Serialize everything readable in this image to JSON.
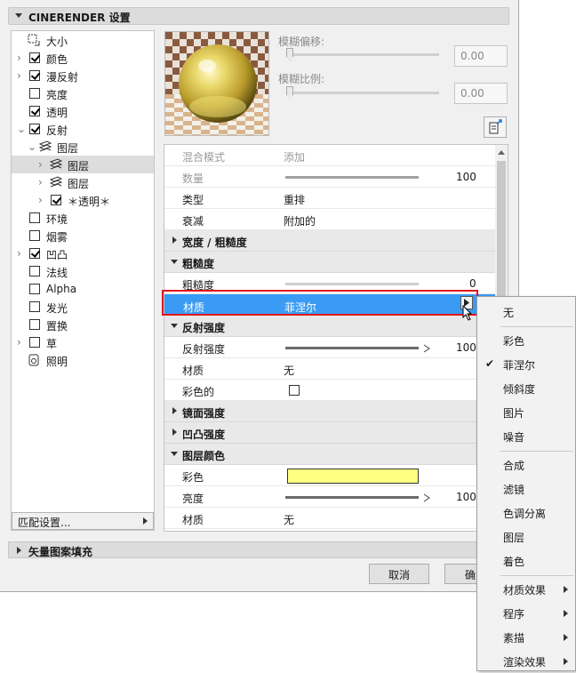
{
  "header": {
    "title": "CINERENDER 设置"
  },
  "tree": {
    "items": [
      {
        "label": "大小",
        "expander": false,
        "checkbox": null,
        "icon": "resize-icon",
        "indent": 0
      },
      {
        "label": "颜色",
        "expander": true,
        "checkbox": true,
        "indent": 0
      },
      {
        "label": "漫反射",
        "expander": true,
        "checkbox": true,
        "indent": 0
      },
      {
        "label": "亮度",
        "expander": false,
        "checkbox": false,
        "indent": 0
      },
      {
        "label": "透明",
        "expander": false,
        "checkbox": true,
        "indent": 0
      },
      {
        "label": "反射",
        "expander": "open",
        "checkbox": true,
        "indent": 0
      },
      {
        "label": "图层",
        "expander": "open",
        "checkbox": null,
        "icon": "layers-icon",
        "indent": 1
      },
      {
        "label": "图层",
        "expander": true,
        "checkbox": null,
        "icon": "layers-icon",
        "indent": 2,
        "selected": true
      },
      {
        "label": "图层",
        "expander": true,
        "checkbox": null,
        "icon": "layers-icon",
        "indent": 2
      },
      {
        "label": "＊透明＊",
        "expander": true,
        "checkbox": true,
        "indent": 2
      },
      {
        "label": "环境",
        "expander": false,
        "checkbox": false,
        "indent": 0
      },
      {
        "label": "烟雾",
        "expander": false,
        "checkbox": false,
        "indent": 0
      },
      {
        "label": "凹凸",
        "expander": true,
        "checkbox": true,
        "indent": 0
      },
      {
        "label": "法线",
        "expander": false,
        "checkbox": false,
        "indent": 0
      },
      {
        "label": "Alpha",
        "expander": false,
        "checkbox": false,
        "indent": 0
      },
      {
        "label": "发光",
        "expander": false,
        "checkbox": false,
        "indent": 0
      },
      {
        "label": "置换",
        "expander": false,
        "checkbox": false,
        "indent": 0
      },
      {
        "label": "草",
        "expander": true,
        "checkbox": false,
        "indent": 0
      },
      {
        "label": "照明",
        "expander": false,
        "checkbox": null,
        "icon": "lighting-icon",
        "indent": 0
      }
    ],
    "match_button": "匹配设置..."
  },
  "blur": {
    "offset_label": "模糊偏移:",
    "offset_value": "0.00",
    "offset_level": 0,
    "scale_label": "模糊比例:",
    "scale_value": "0.00",
    "scale_level": 0
  },
  "props": [
    {
      "type": "row",
      "dim": true,
      "key": "混合模式",
      "value": "添加"
    },
    {
      "type": "slider",
      "dim": true,
      "key": "数量",
      "value": "100",
      "level": 1.0
    },
    {
      "type": "row",
      "key": "类型",
      "value": "重排"
    },
    {
      "type": "row",
      "key": "衰减",
      "value": "附加的"
    },
    {
      "type": "group",
      "open": false,
      "key": "宽度 / 粗糙度"
    },
    {
      "type": "group",
      "open": true,
      "key": "粗糙度"
    },
    {
      "type": "slider",
      "key": "粗糙度",
      "value": "0",
      "level": 0.0
    },
    {
      "type": "row",
      "key": "材质",
      "value": "菲涅尔",
      "selected": true
    },
    {
      "type": "group",
      "open": true,
      "key": "反射强度"
    },
    {
      "type": "slider",
      "key": "反射强度",
      "value": "100",
      "level": 1.0,
      "arrow": true
    },
    {
      "type": "row",
      "key": "材质",
      "value": "无"
    },
    {
      "type": "check",
      "key": "彩色的",
      "checked": false
    },
    {
      "type": "group",
      "open": false,
      "key": "镜面强度"
    },
    {
      "type": "group",
      "open": false,
      "key": "凹凸强度"
    },
    {
      "type": "group",
      "open": true,
      "key": "图层颜色"
    },
    {
      "type": "color",
      "key": "彩色",
      "color": "#ffff80"
    },
    {
      "type": "slider",
      "key": "亮度",
      "value": "100",
      "level": 1.0,
      "arrow": true
    },
    {
      "type": "row",
      "key": "材质",
      "value": "无"
    }
  ],
  "bottom": {
    "vector_title": "矢量图案填充",
    "cancel": "取消",
    "ok": "确"
  },
  "menu": {
    "items": [
      {
        "label": "无"
      },
      {
        "sep": true
      },
      {
        "label": "彩色"
      },
      {
        "label": "菲涅尔",
        "checked": true
      },
      {
        "label": "倾斜度"
      },
      {
        "label": "图片"
      },
      {
        "label": "噪音"
      },
      {
        "sep": true
      },
      {
        "label": "合成"
      },
      {
        "label": "滤镜"
      },
      {
        "label": "色调分离"
      },
      {
        "label": "图层"
      },
      {
        "label": "着色"
      },
      {
        "sep": true
      },
      {
        "label": "材质效果",
        "submenu": true
      },
      {
        "label": "程序",
        "submenu": true
      },
      {
        "label": "素描",
        "submenu": true
      },
      {
        "label": "渲染效果",
        "submenu": true
      }
    ]
  },
  "colors": {
    "selection": "#3a9bf4",
    "highlight": "#e3161b",
    "swatch": "#ffff80"
  }
}
